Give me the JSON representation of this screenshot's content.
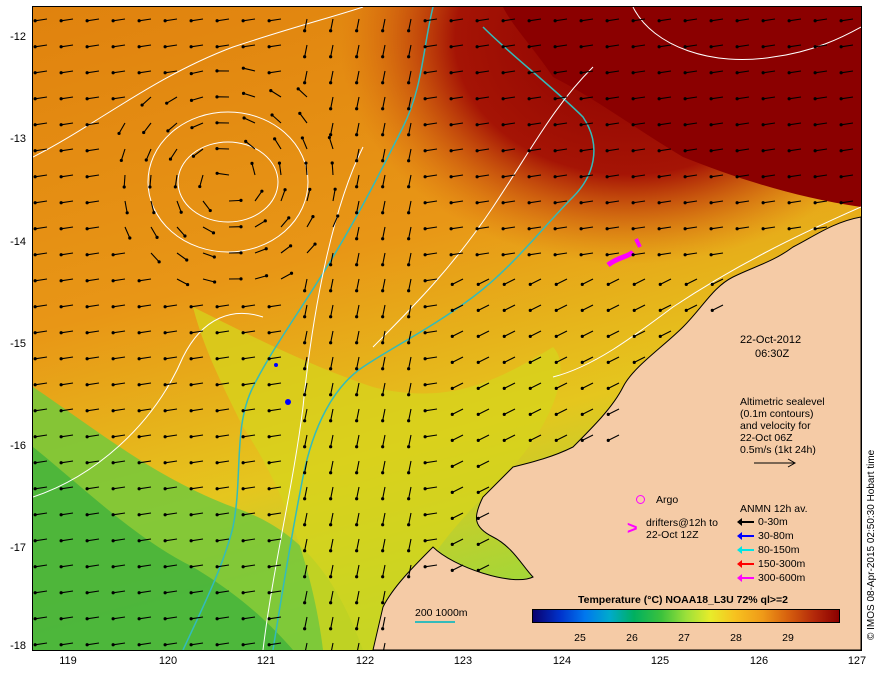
{
  "map": {
    "y_labels": [
      "-12",
      "-13",
      "-14",
      "-15",
      "-16",
      "-17",
      "-18"
    ],
    "x_labels": [
      "119",
      "120",
      "121",
      "122",
      "123",
      "124",
      "125",
      "126",
      "127"
    ],
    "date": "22-Oct-2012",
    "time": "06:30Z",
    "altimetry_lines": [
      "Altimetric sealevel",
      "(0.1m contours)",
      "and velocity for",
      "22-Oct 06Z",
      "0.5m/s (1kt 24h)"
    ],
    "argo_label": "Argo",
    "drifters_lines": [
      "drifters@12h to",
      "22-Oct 12Z"
    ],
    "anmn_title": "ANMN 12h av.",
    "anmn_items": [
      {
        "label": "0-30m",
        "color": "#000000"
      },
      {
        "label": "30-80m",
        "color": "#0000ff"
      },
      {
        "label": "80-150m",
        "color": "#00e5e5"
      },
      {
        "label": "150-300m",
        "color": "#ff0000"
      },
      {
        "label": "300-600m",
        "color": "#ff00ff"
      }
    ],
    "isobath_label": "200  1000m",
    "colorbar_title": "Temperature (°C) NOAA18_L3U 72% ql>=2",
    "colorbar_ticks": [
      "25",
      "26",
      "27",
      "28",
      "29"
    ],
    "credit": "© IMOS 08-Apr-2015 02:50:30 Hobart time",
    "colors": {
      "land": "#f5cba6",
      "warm": "#8b0000",
      "sst_mid": "#e08a10",
      "isobath": "#33bbbb",
      "contour": "#ffffff"
    }
  }
}
